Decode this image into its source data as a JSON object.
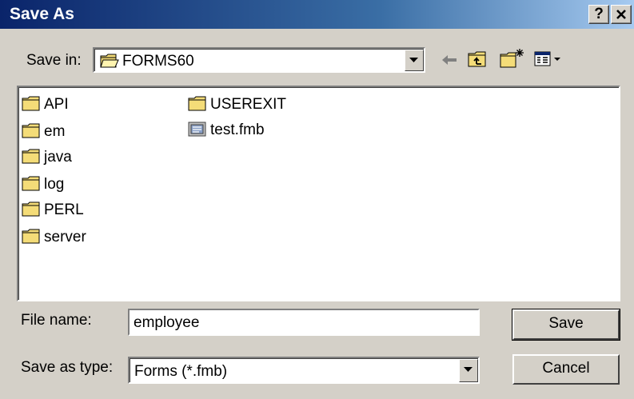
{
  "window": {
    "title": "Save As",
    "help_label": "?",
    "close_label": "✕"
  },
  "save_in": {
    "label": "Save in:",
    "value": "FORMS60"
  },
  "toolbar": {
    "back_icon": "back-arrow-icon",
    "up_icon": "up-one-level-icon",
    "new_folder_icon": "new-folder-icon",
    "view_menu_icon": "view-menu-icon"
  },
  "files": {
    "col1": [
      {
        "name": "API",
        "type": "folder"
      },
      {
        "name": "em",
        "type": "folder"
      },
      {
        "name": "java",
        "type": "folder"
      },
      {
        "name": "log",
        "type": "folder"
      },
      {
        "name": "PERL",
        "type": "folder"
      },
      {
        "name": "server",
        "type": "folder"
      }
    ],
    "col2": [
      {
        "name": "USEREXIT",
        "type": "folder"
      },
      {
        "name": "test.fmb",
        "type": "file"
      }
    ]
  },
  "file_name": {
    "label": "File name:",
    "value": "employee"
  },
  "save_as_type": {
    "label": "Save as type:",
    "value": "Forms (*.fmb)"
  },
  "buttons": {
    "save": "Save",
    "cancel": "Cancel"
  },
  "colors": {
    "titlebar_start": "#0a246a",
    "dialog_bg": "#d4d0c8",
    "folder": "#f4dc78"
  }
}
